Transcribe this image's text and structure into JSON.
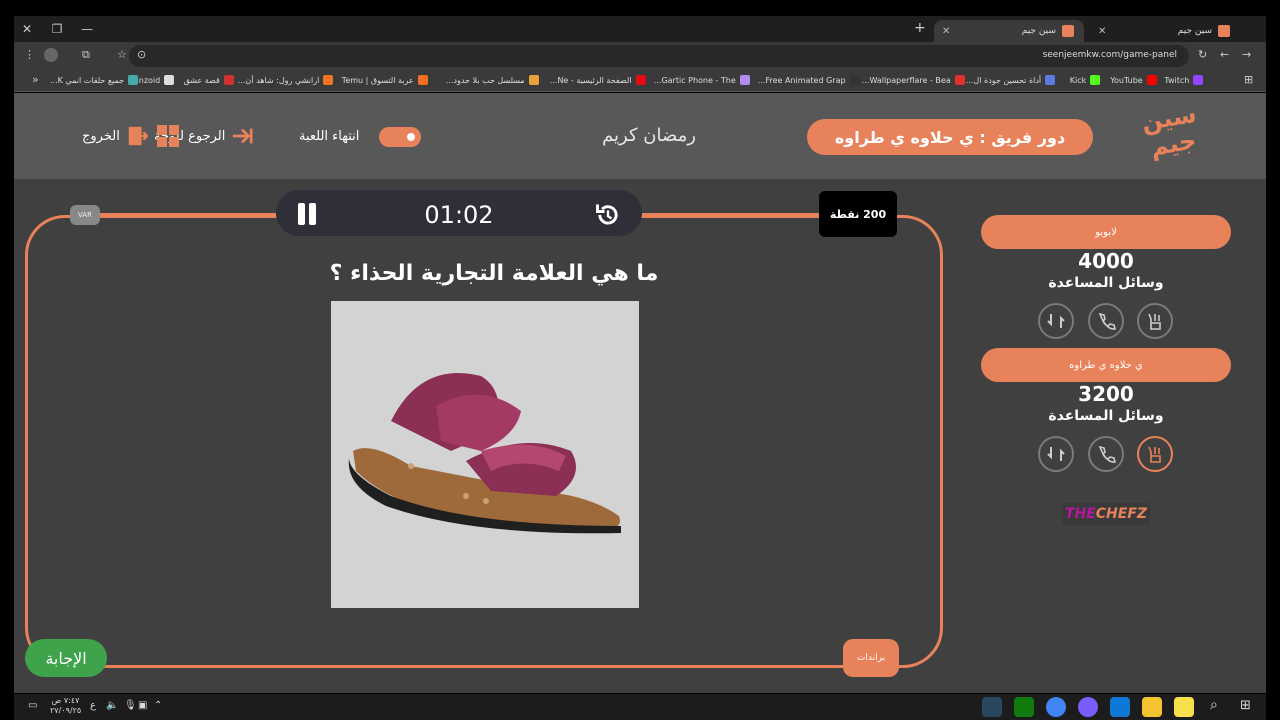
{
  "browser": {
    "tabs": [
      {
        "title": "سين جيم",
        "active": false
      },
      {
        "title": "سين جيم",
        "active": true
      }
    ],
    "url": "seenjeemkw.com/game-panel"
  },
  "bookmarks": [
    {
      "label": "Twitch",
      "color": "#9146ff"
    },
    {
      "label": "YouTube",
      "color": "#ff0000"
    },
    {
      "label": "Kick",
      "color": "#53fc18"
    },
    {
      "label": "أداة تحسين جودة ال...",
      "color": "#5b7be0"
    },
    {
      "label": "Wallpaperflare - Bea...",
      "color": "#d33"
    },
    {
      "label": "Free Animated Grap...",
      "color": "#333"
    },
    {
      "label": "Gartic Phone - The...",
      "color": "#b48cf0"
    },
    {
      "label": "الصفحة الرئيسية - Ne...",
      "color": "#e50914"
    },
    {
      "label": "مسلسل حب بلا حدود...",
      "color": "#e8a33a"
    },
    {
      "label": "عربة التسوق | Temu",
      "color": "#f26f21"
    },
    {
      "label": "ارانشي رول: شاهد أن...",
      "color": "#f47521"
    },
    {
      "label": "قصة عشق",
      "color": "#c33"
    },
    {
      "label": "Panzoid",
      "color": "#ddd"
    },
    {
      "label": "جميع حلقات انمي K...",
      "color": "#4aa"
    }
  ],
  "header": {
    "turn_label": "دور فريق : ي حلاوه ي طراوه",
    "player_name": "رمضان كريم",
    "end_game": "انتهاء اللعبة",
    "back_to_board": "الرجوع للوحة",
    "exit": "الخروج",
    "logo_text": "سين جيم"
  },
  "game": {
    "timer": "01:02",
    "points": "200 نقطة",
    "chip_label": "VAR",
    "question": "ما هي العلامة التجارية الحذاء ؟",
    "answer_button": "الإجابة",
    "category_chip": "براندات"
  },
  "teams": [
    {
      "name": "لابوبو",
      "score": "4000",
      "help_label": "وسائل المساعدة",
      "aids": [
        "swap",
        "call",
        "hand"
      ],
      "used": []
    },
    {
      "name": "ي حلاوه ي طراوه",
      "score": "3200",
      "help_label": "وسائل المساعدة",
      "aids": [
        "swap",
        "call",
        "hand"
      ],
      "used": [
        "hand"
      ]
    }
  ],
  "sponsor": {
    "part1": "THE",
    "part2": "CHEFZ"
  },
  "taskbar": {
    "time": "٧:٤٧ ص",
    "date": "٢٧/٠٩/٢٥",
    "lang": "ع"
  },
  "colors": {
    "accent": "#e8825a",
    "answer_green": "#3ea34a",
    "page_bg": "#404040",
    "header_bg": "#585858"
  }
}
